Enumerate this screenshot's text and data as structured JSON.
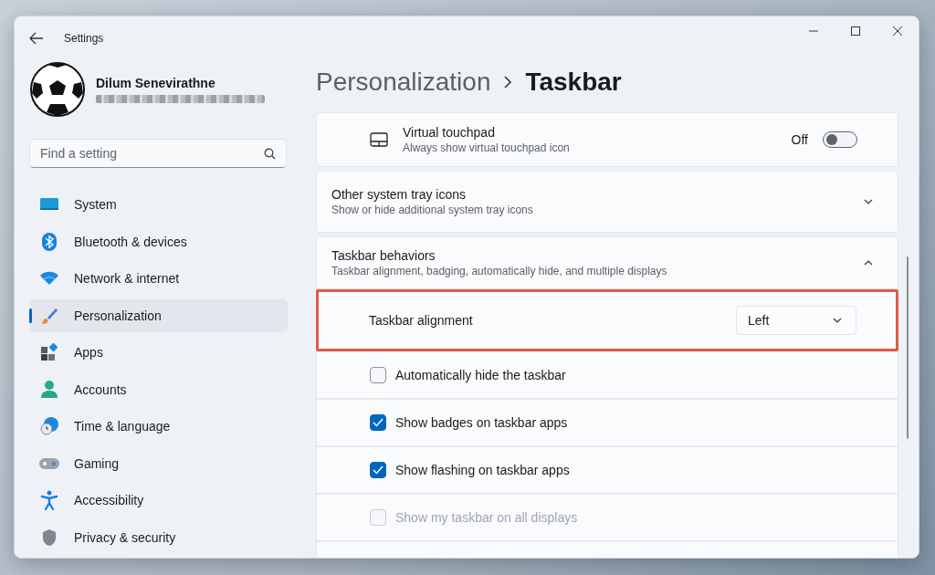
{
  "window": {
    "title": "Settings"
  },
  "user": {
    "name": "Dilum Senevirathne"
  },
  "search": {
    "placeholder": "Find a setting"
  },
  "nav": [
    {
      "label": "System",
      "selected": false
    },
    {
      "label": "Bluetooth & devices",
      "selected": false
    },
    {
      "label": "Network & internet",
      "selected": false
    },
    {
      "label": "Personalization",
      "selected": true
    },
    {
      "label": "Apps",
      "selected": false
    },
    {
      "label": "Accounts",
      "selected": false
    },
    {
      "label": "Time & language",
      "selected": false
    },
    {
      "label": "Gaming",
      "selected": false
    },
    {
      "label": "Accessibility",
      "selected": false
    },
    {
      "label": "Privacy & security",
      "selected": false
    }
  ],
  "breadcrumb": {
    "parent": "Personalization",
    "current": "Taskbar"
  },
  "settings": [
    {
      "kind": "toggle",
      "title": "Virtual touchpad",
      "description": "Always show virtual touchpad icon",
      "state_label": "Off",
      "on": false
    },
    {
      "kind": "expander",
      "title": "Other system tray icons",
      "description": "Show or hide additional system tray icons",
      "expanded": false
    },
    {
      "kind": "expander",
      "title": "Taskbar behaviors",
      "description": "Taskbar alignment, badging, automatically hide, and multiple displays",
      "expanded": true
    },
    {
      "kind": "dropdown",
      "label": "Taskbar alignment",
      "value": "Left",
      "highlighted": true
    },
    {
      "kind": "checkbox",
      "label": "Automatically hide the taskbar",
      "checked": false,
      "disabled": false
    },
    {
      "kind": "checkbox",
      "label": "Show badges on taskbar apps",
      "checked": true,
      "disabled": false
    },
    {
      "kind": "checkbox",
      "label": "Show flashing on taskbar apps",
      "checked": true,
      "disabled": false
    },
    {
      "kind": "checkbox",
      "label": "Show my taskbar on all displays",
      "checked": false,
      "disabled": true
    }
  ]
}
